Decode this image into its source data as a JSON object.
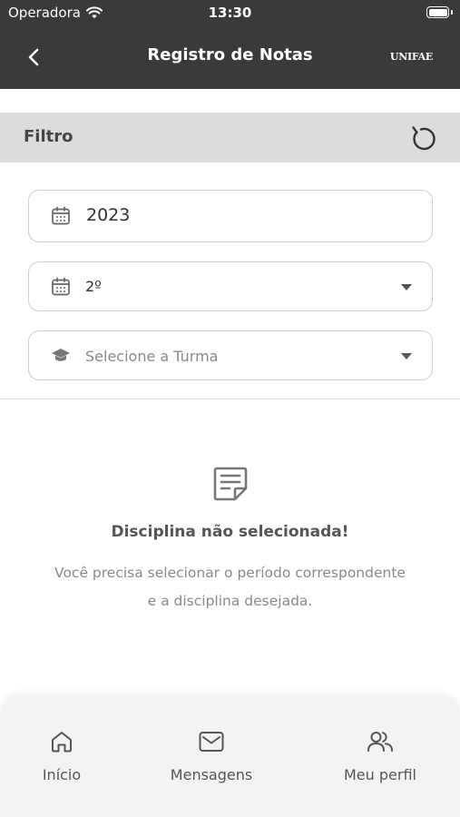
{
  "status_bar": {
    "carrier": "Operadora",
    "time": "13:30"
  },
  "header": {
    "title": "Registro de Notas",
    "brand": "UNIFAE"
  },
  "filter": {
    "label": "Filtro",
    "year_value": "2023",
    "period_value": "2º",
    "class_placeholder": "Selecione a Turma"
  },
  "empty_state": {
    "title": "Disciplina não selecionada!",
    "description": "Você precisa selecionar o período correspondente e a disciplina desejada."
  },
  "tabbar": {
    "items": [
      {
        "label": "Início",
        "icon": "home-icon"
      },
      {
        "label": "Mensagens",
        "icon": "envelope-icon"
      },
      {
        "label": "Meu perfil",
        "icon": "users-icon"
      }
    ]
  },
  "colors": {
    "header_bg": "#3a3a3a",
    "filter_bg": "#dcdcdc",
    "tabbar_bg": "#f3f3f3"
  }
}
